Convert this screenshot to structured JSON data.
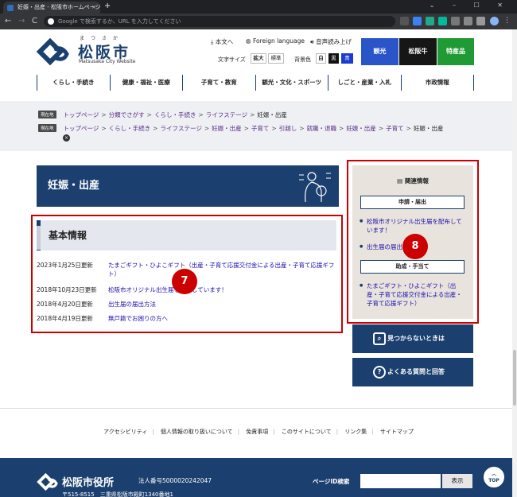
{
  "browser": {
    "tab_title": "妊娠・出産 - 松阪市ホームページ",
    "tab_close": "×",
    "new_tab": "+",
    "back": "←",
    "forward": "→",
    "reload": "C",
    "address_placeholder": "Google で検索するか、URL を入力してください"
  },
  "header": {
    "logo_ruby": "まつさか",
    "logo_name": "松阪市",
    "logo_en": "Matsusaka City Website",
    "text_only": "本文へ",
    "foreign": "Foreign language",
    "read_aloud": "音声読み上げ",
    "font_size_label": "文字サイズ",
    "font_size_large": "拡大",
    "font_size_normal": "標準",
    "bg_color_label": "背景色",
    "bg_white": "白",
    "bg_black": "黒",
    "bg_blue": "青",
    "banners": [
      {
        "label": "観光",
        "color": "#2a55c9"
      },
      {
        "label": "松阪牛",
        "color": "#161616"
      },
      {
        "label": "特産品",
        "color": "#1f9a35"
      }
    ]
  },
  "global_nav": [
    "くらし・手続き",
    "健康・福祉・医療",
    "子育て・教育",
    "観光・文化・スポーツ",
    "しごと・産業・入札",
    "市政情報"
  ],
  "breadcrumbs": {
    "row1": {
      "badge": "現在地",
      "links": [
        "トップページ",
        "分類でさがす",
        "くらし・手続き",
        "ライフステージ"
      ],
      "current": "妊娠・出産"
    },
    "row2": {
      "badge": "現在地",
      "links": [
        "トップページ",
        "くらし・手続き",
        "ライフステージ",
        "妊娠・出産",
        "子育て",
        "引越し",
        "就職・退職",
        "妊娠・出産",
        "子育て"
      ],
      "current": "妊娠・出産"
    },
    "separator": ">",
    "close": "×"
  },
  "main": {
    "page_title": "妊娠・出産",
    "section_title": "基本情報",
    "news": [
      {
        "date": "2023年1月25日更新",
        "text": "たまごギフト・ひよこギフト（出産・子育て応援交付金による出産・子育て応援ギフト）"
      },
      {
        "date": "2018年10月23日更新",
        "text": "松阪市オリジナル出生届を配布しています！"
      },
      {
        "date": "2018年4月20日更新",
        "text": "出生届の届出方法"
      },
      {
        "date": "2018年4月19日更新",
        "text": "無戸籍でお困りの方へ"
      }
    ]
  },
  "sidebar": {
    "title": "関連情報",
    "groups": [
      {
        "heading": "申請・届出",
        "links": [
          "松阪市オリジナル出生届を配布しています！",
          "出生届の届出方法"
        ]
      },
      {
        "heading": "助成・手当て",
        "links": [
          "たまごギフト・ひよこギフト（出産・子育て応援交付金による出産・子育て応援ギフト）"
        ]
      }
    ],
    "not_found_button": "見つからないときは",
    "faq_button": "よくある質問と回答"
  },
  "callouts": {
    "left": "7",
    "right": "8"
  },
  "footer": {
    "links": [
      "アクセシビリティ",
      "個人情報の取り扱いについて",
      "免責事項",
      "このサイトについて",
      "リンク集",
      "サイトマップ"
    ],
    "link_separator": "|",
    "city_hall": "松阪市役所",
    "corporate_number": "法人番号5000020242047",
    "address": "〒515-8515　三重県松阪市殿町1340番地1",
    "page_id_label": "ページID検索",
    "search_button": "表示",
    "top_button": "TOP"
  },
  "colors": {
    "navy": "#1b3f6e",
    "callout_red": "#cc0000",
    "sidebar_bg": "#e8e3dd"
  }
}
